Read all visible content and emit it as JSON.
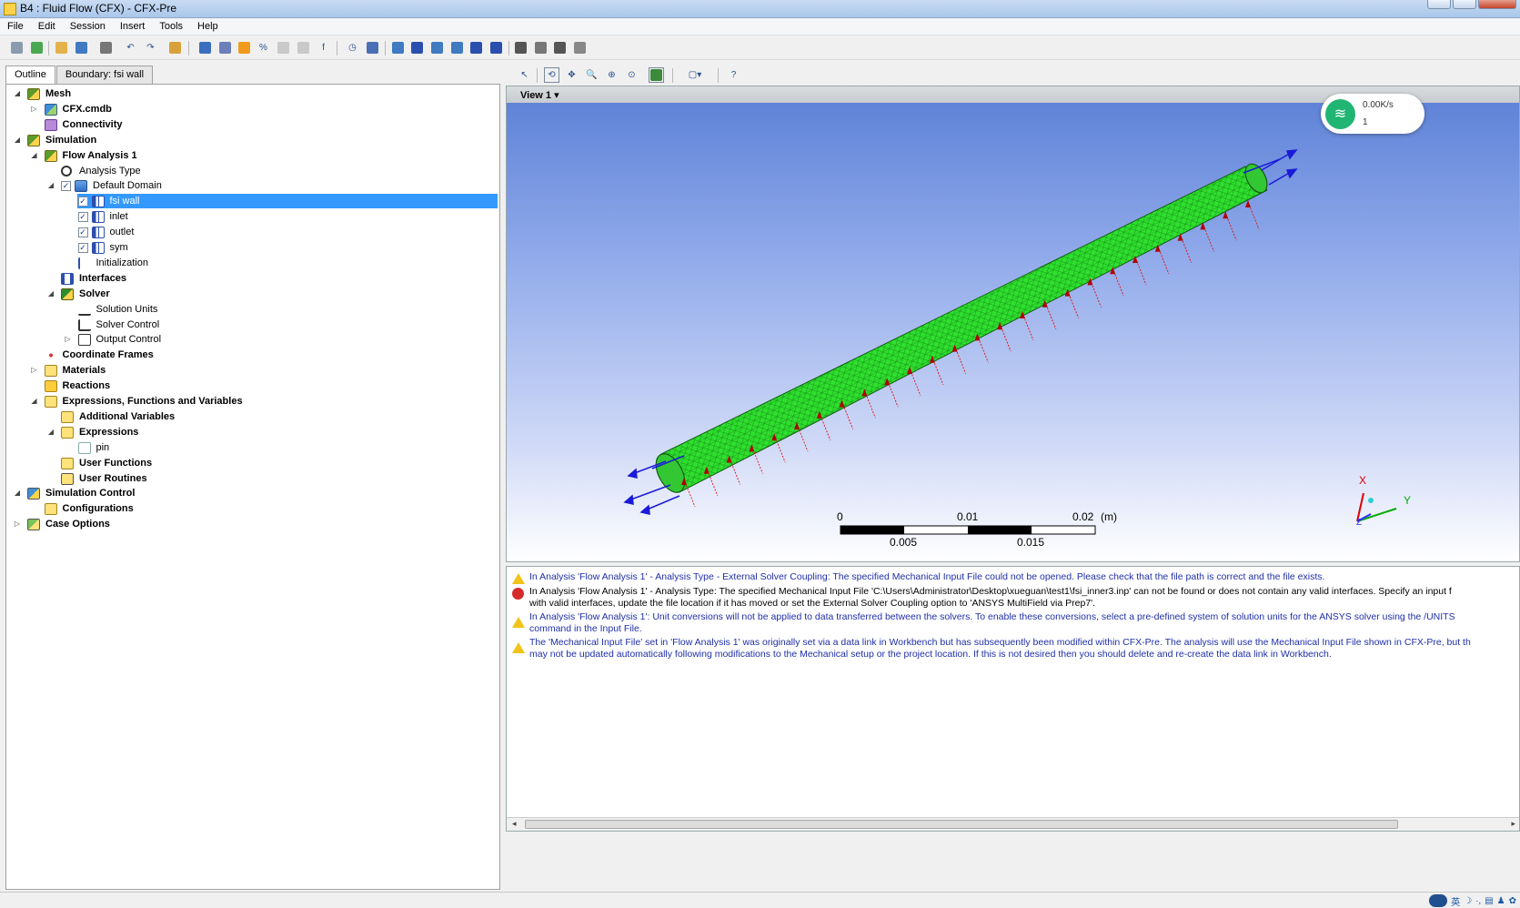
{
  "window": {
    "title": "B4 : Fluid Flow (CFX) - CFX-Pre"
  },
  "menu": [
    "File",
    "Edit",
    "Session",
    "Insert",
    "Tools",
    "Help"
  ],
  "tabs": [
    "Outline",
    "Boundary: fsi wall"
  ],
  "tree": [
    {
      "label": "Mesh",
      "bold": true,
      "indent": 0,
      "exp": "open",
      "icon": "mesh-icon"
    },
    {
      "label": "CFX.cmdb",
      "bold": true,
      "indent": 1,
      "exp": "closed",
      "icon": "mesh-file-icon"
    },
    {
      "label": "Connectivity",
      "bold": true,
      "indent": 1,
      "exp": "",
      "icon": "connectivity-icon"
    },
    {
      "label": "Simulation",
      "bold": true,
      "indent": 0,
      "exp": "open",
      "icon": "simulation-icon"
    },
    {
      "label": "Flow Analysis 1",
      "bold": true,
      "indent": 1,
      "exp": "open",
      "icon": "flow-analysis-icon"
    },
    {
      "label": "Analysis Type",
      "bold": false,
      "indent": 2,
      "exp": "",
      "icon": "clock-icon"
    },
    {
      "label": "Default Domain",
      "bold": false,
      "indent": 2,
      "exp": "open",
      "icon": "domain-icon",
      "check": true
    },
    {
      "label": "fsi wall",
      "bold": false,
      "indent": 3,
      "exp": "",
      "icon": "boundary-icon",
      "check": true,
      "selected": true
    },
    {
      "label": "inlet",
      "bold": false,
      "indent": 3,
      "exp": "",
      "icon": "boundary-icon",
      "check": true
    },
    {
      "label": "outlet",
      "bold": false,
      "indent": 3,
      "exp": "",
      "icon": "boundary-icon",
      "check": true
    },
    {
      "label": "sym",
      "bold": false,
      "indent": 3,
      "exp": "",
      "icon": "boundary-icon",
      "check": true
    },
    {
      "label": "Initialization",
      "bold": false,
      "indent": 3,
      "exp": "",
      "icon": "initialization-icon"
    },
    {
      "label": "Interfaces",
      "bold": true,
      "indent": 2,
      "exp": "",
      "icon": "interfaces-icon"
    },
    {
      "label": "Solver",
      "bold": true,
      "indent": 2,
      "exp": "open",
      "icon": "solver-icon"
    },
    {
      "label": "Solution Units",
      "bold": false,
      "indent": 3,
      "exp": "",
      "icon": "solution-units-icon"
    },
    {
      "label": "Solver Control",
      "bold": false,
      "indent": 3,
      "exp": "",
      "icon": "solver-control-icon"
    },
    {
      "label": "Output Control",
      "bold": false,
      "indent": 3,
      "exp": "closed",
      "icon": "output-control-icon"
    },
    {
      "label": "Coordinate Frames",
      "bold": true,
      "indent": 1,
      "exp": "",
      "icon": "coordinate-frames-icon"
    },
    {
      "label": "Materials",
      "bold": true,
      "indent": 1,
      "exp": "closed",
      "icon": "materials-icon"
    },
    {
      "label": "Reactions",
      "bold": true,
      "indent": 1,
      "exp": "",
      "icon": "reactions-icon"
    },
    {
      "label": "Expressions, Functions and Variables",
      "bold": true,
      "indent": 1,
      "exp": "open",
      "icon": "expressions-icon"
    },
    {
      "label": "Additional Variables",
      "bold": true,
      "indent": 2,
      "exp": "",
      "icon": "additional-variables-icon"
    },
    {
      "label": "Expressions",
      "bold": true,
      "indent": 2,
      "exp": "open",
      "icon": "expressions-folder-icon"
    },
    {
      "label": "pin",
      "bold": false,
      "indent": 3,
      "exp": "",
      "icon": "expression-icon"
    },
    {
      "label": "User Functions",
      "bold": true,
      "indent": 2,
      "exp": "",
      "icon": "user-functions-icon"
    },
    {
      "label": "User Routines",
      "bold": true,
      "indent": 2,
      "exp": "",
      "icon": "user-routines-icon"
    },
    {
      "label": "Simulation Control",
      "bold": true,
      "indent": 0,
      "exp": "open",
      "icon": "simulation-control-icon"
    },
    {
      "label": "Configurations",
      "bold": true,
      "indent": 1,
      "exp": "",
      "icon": "configurations-icon"
    },
    {
      "label": "Case Options",
      "bold": true,
      "indent": 0,
      "exp": "closed",
      "icon": "case-options-icon"
    }
  ],
  "viewer": {
    "view_label": "View 1",
    "net_speed": "0.00K/s",
    "net_count": "1",
    "scale": {
      "top": [
        "0",
        "0.01",
        "0.02",
        "(m)"
      ],
      "bottom": [
        "0.005",
        "0.015"
      ]
    },
    "axes": {
      "x": "X",
      "y": "Y",
      "z": "Z"
    }
  },
  "messages": [
    {
      "type": "warning",
      "color": "blue",
      "text": "In Analysis 'Flow Analysis 1' - Analysis Type - External Solver Coupling: The specified Mechanical Input File could not be opened. Please check that the file path is correct and the file exists."
    },
    {
      "type": "error",
      "color": "black",
      "text": "In Analysis 'Flow Analysis 1' - Analysis Type: The specified Mechanical Input File 'C:\\Users\\Administrator\\Desktop\\xueguan\\test1\\fsi_inner3.inp' can not be found or does not contain any valid interfaces. Specify an input f\nwith valid interfaces, update the file location if it has moved or set the External Solver Coupling option to 'ANSYS MultiField via Prep7'."
    },
    {
      "type": "warning",
      "color": "blue",
      "text": "In Analysis 'Flow Analysis 1': Unit conversions will not be applied to data transferred between the solvers. To enable these conversions, select a pre-defined system of solution units for the ANSYS solver using the /UNITS\ncommand in the Input File."
    },
    {
      "type": "warning",
      "color": "blue",
      "text": "The 'Mechanical Input File' set in 'Flow Analysis 1' was originally set via a data link in Workbench but has subsequently been modified within CFX-Pre. The analysis will use the Mechanical Input File shown in CFX-Pre, but th\nmay not be updated automatically following modifications to the Mechanical setup or the project location. If this is not desired then you should delete and re-create the data link in Workbench."
    }
  ],
  "statusbar": {
    "ime_label": "英"
  }
}
